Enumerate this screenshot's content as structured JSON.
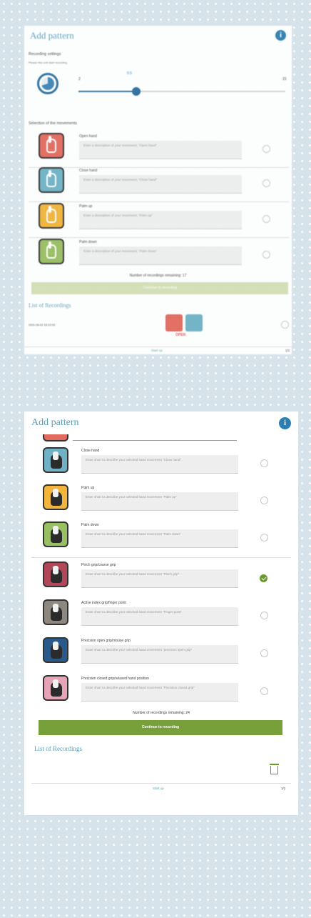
{
  "panel1": {
    "title": "Add pattern",
    "info_glyph": "i",
    "recording_settings_label": "Recording settings",
    "recording_settings_hint": "Please this unit start recording",
    "slider": {
      "min_label": "2",
      "value_label": "0.5",
      "max_label": "15",
      "level_fraction": 0.28
    },
    "selection_label": "Selection of the movements",
    "movements": [
      {
        "name": "Open hand",
        "placeholder": "Enter a description of your movement, \"Open hand\"",
        "color": "#e46a5e",
        "icon": "open-hand-icon"
      },
      {
        "name": "Close hand",
        "placeholder": "Enter a description of your movement, \"Close hand\"",
        "color": "#6fb2c6",
        "icon": "close-hand-icon"
      },
      {
        "name": "Palm up",
        "placeholder": "Enter a description of your movement, \"Palm up\"",
        "color": "#f2b43a",
        "icon": "palm-up-icon"
      },
      {
        "name": "Palm down",
        "placeholder": "Enter a description of your movement, \"Palm down\"",
        "color": "#98bf62",
        "icon": "palm-down-icon"
      }
    ],
    "remaining_label": "Number of recordings remaining: 17",
    "continue_label": "Continue to recording",
    "list_title": "List of Recordings",
    "recording_date": "2021-06-02 15:22:03",
    "recording_badge": "OPEN",
    "footer_left": "Start up",
    "footer_right": "1/1"
  },
  "panel2": {
    "title": "Add pattern",
    "info_glyph": "i",
    "movements": [
      {
        "name": "Close hand",
        "placeholder": "Enter short to describe your selected hand movement \"Close hand\"",
        "color": "#6fb2c6",
        "checked": false
      },
      {
        "name": "Palm up",
        "placeholder": "Enter short to describe your selected hand movement \"Palm up\"",
        "color": "#f2b43a",
        "checked": false
      },
      {
        "name": "Palm down",
        "placeholder": "Enter short to describe your selected hand movement \"Palm down\"",
        "color": "#98bf62",
        "checked": false
      },
      {
        "name": "Pinch grip/coarse grip",
        "placeholder": "Enter short to describe your selected hand movement \"Pinch grip\"",
        "color": "#b14758",
        "checked": true
      },
      {
        "name": "Active index grip/finger point",
        "placeholder": "Enter short to describe your selected hand movement \"Finger point\"",
        "color": "#8d8780",
        "checked": false
      },
      {
        "name": "Precision open grip/mouse grip",
        "placeholder": "Enter short to describe your selected hand movement \"precision open grip\"",
        "color": "#2a5a8a",
        "checked": false
      },
      {
        "name": "Precision closed grip/relaxed hand position",
        "placeholder": "Enter short to describe your selected hand movement \"Precision closed grip\"",
        "color": "#e7a4b6",
        "checked": false
      }
    ],
    "remaining_label": "Number of recordings remaining: 24",
    "continue_label": "Continue to recording",
    "list_title": "List of Recordings",
    "footer_left": "Start up",
    "footer_right": "1/1"
  }
}
